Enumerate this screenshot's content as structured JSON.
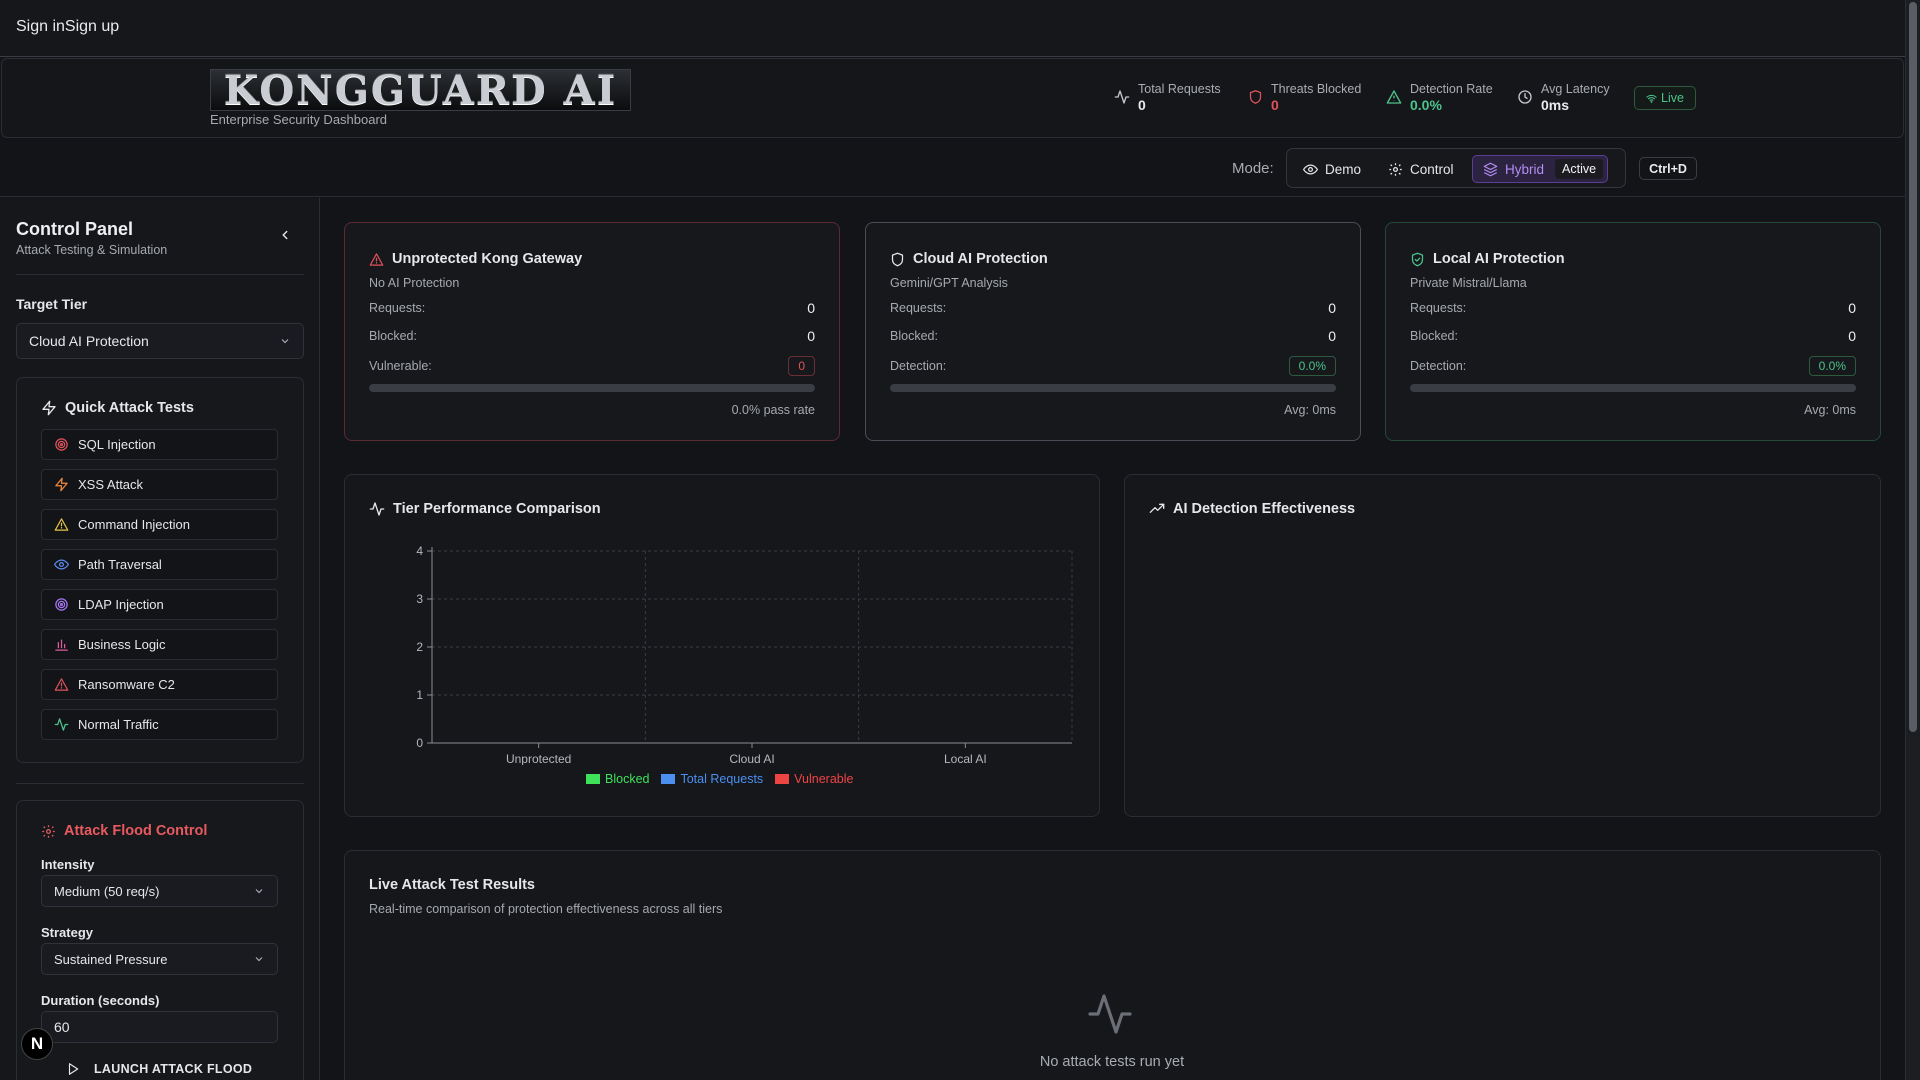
{
  "auth": {
    "sign_in": "Sign in",
    "sign_up": "Sign up"
  },
  "header": {
    "logo_text": "KONGGUARD AI",
    "subtitle": "Enterprise Security Dashboard",
    "stats": [
      {
        "label": "Total Requests",
        "value": "0",
        "color": "#e9eaee"
      },
      {
        "label": "Threats Blocked",
        "value": "0",
        "color": "#e0525a"
      },
      {
        "label": "Detection Rate",
        "value": "0.0%",
        "color": "#4cc38a"
      },
      {
        "label": "Avg Latency",
        "value": "0ms",
        "color": "#e9eaee"
      }
    ],
    "live_label": "Live"
  },
  "mode": {
    "label": "Mode:",
    "options": [
      "Demo",
      "Control",
      "Hybrid"
    ],
    "selected": "Hybrid",
    "active_tag": "Active",
    "shortcut": "Ctrl+D"
  },
  "sidebar": {
    "title": "Control Panel",
    "subtitle": "Attack Testing & Simulation",
    "target_tier_label": "Target Tier",
    "target_tier_value": "Cloud AI Protection",
    "quick_tests": {
      "title": "Quick Attack Tests",
      "items": [
        {
          "label": "SQL Injection",
          "icon": "target-icon",
          "color": "#e0525a"
        },
        {
          "label": "XSS Attack",
          "icon": "zap-icon",
          "color": "#f08a3c"
        },
        {
          "label": "Command Injection",
          "icon": "alert-triangle-icon",
          "color": "#e8c547"
        },
        {
          "label": "Path Traversal",
          "icon": "eye-icon",
          "color": "#5b8def"
        },
        {
          "label": "LDAP Injection",
          "icon": "target-icon",
          "color": "#a675f0"
        },
        {
          "label": "Business Logic",
          "icon": "bar-chart-icon",
          "color": "#e05aa0"
        },
        {
          "label": "Ransomware C2",
          "icon": "alert-triangle-icon",
          "color": "#e0525a"
        },
        {
          "label": "Normal Traffic",
          "icon": "activity-icon",
          "color": "#4cc38a"
        }
      ]
    },
    "flood": {
      "title": "Attack Flood Control",
      "intensity_label": "Intensity",
      "intensity_value": "Medium (50 req/s)",
      "strategy_label": "Strategy",
      "strategy_value": "Sustained Pressure",
      "duration_label": "Duration (seconds)",
      "duration_value": "60",
      "launch_label": "LAUNCH ATTACK FLOOD"
    },
    "badge": "N"
  },
  "tiers": [
    {
      "title": "Unprotected Kong Gateway",
      "desc": "No AI Protection",
      "requests_label": "Requests:",
      "requests": "0",
      "blocked_label": "Blocked:",
      "blocked": "0",
      "metric_label": "Vulnerable:",
      "metric": "0",
      "progress": 0,
      "footer": "0.0% pass rate",
      "accent": "#e0525a"
    },
    {
      "title": "Cloud AI Protection",
      "desc": "Gemini/GPT Analysis",
      "requests_label": "Requests:",
      "requests": "0",
      "blocked_label": "Blocked:",
      "blocked": "0",
      "metric_label": "Detection:",
      "metric": "0.0%",
      "progress": 0,
      "footer": "Avg: 0ms",
      "accent": "#e6e7ea"
    },
    {
      "title": "Local AI Protection",
      "desc": "Private Mistral/Llama",
      "requests_label": "Requests:",
      "requests": "0",
      "blocked_label": "Blocked:",
      "blocked": "0",
      "metric_label": "Detection:",
      "metric": "0.0%",
      "progress": 0,
      "footer": "Avg: 0ms",
      "accent": "#4cc38a"
    }
  ],
  "performance": {
    "title": "Tier Performance Comparison",
    "chart_data": {
      "type": "bar",
      "categories": [
        "Unprotected",
        "Cloud AI",
        "Local AI"
      ],
      "series": [
        {
          "name": "Blocked",
          "color": "#3fe05a",
          "values": [
            0,
            0,
            0
          ]
        },
        {
          "name": "Total Requests",
          "color": "#4b8ff0",
          "values": [
            0,
            0,
            0
          ]
        },
        {
          "name": "Vulnerable",
          "color": "#ef4444",
          "values": [
            0,
            0,
            0
          ]
        }
      ],
      "yticks": [
        "0",
        "1",
        "2",
        "3",
        "4"
      ],
      "ylim": [
        0,
        4
      ],
      "grid": true,
      "legend": "bottom"
    }
  },
  "effectiveness": {
    "title": "AI Detection Effectiveness"
  },
  "results": {
    "title": "Live Attack Test Results",
    "subtitle": "Real-time comparison of protection effectiveness across all tiers",
    "empty": "No attack tests run yet"
  }
}
